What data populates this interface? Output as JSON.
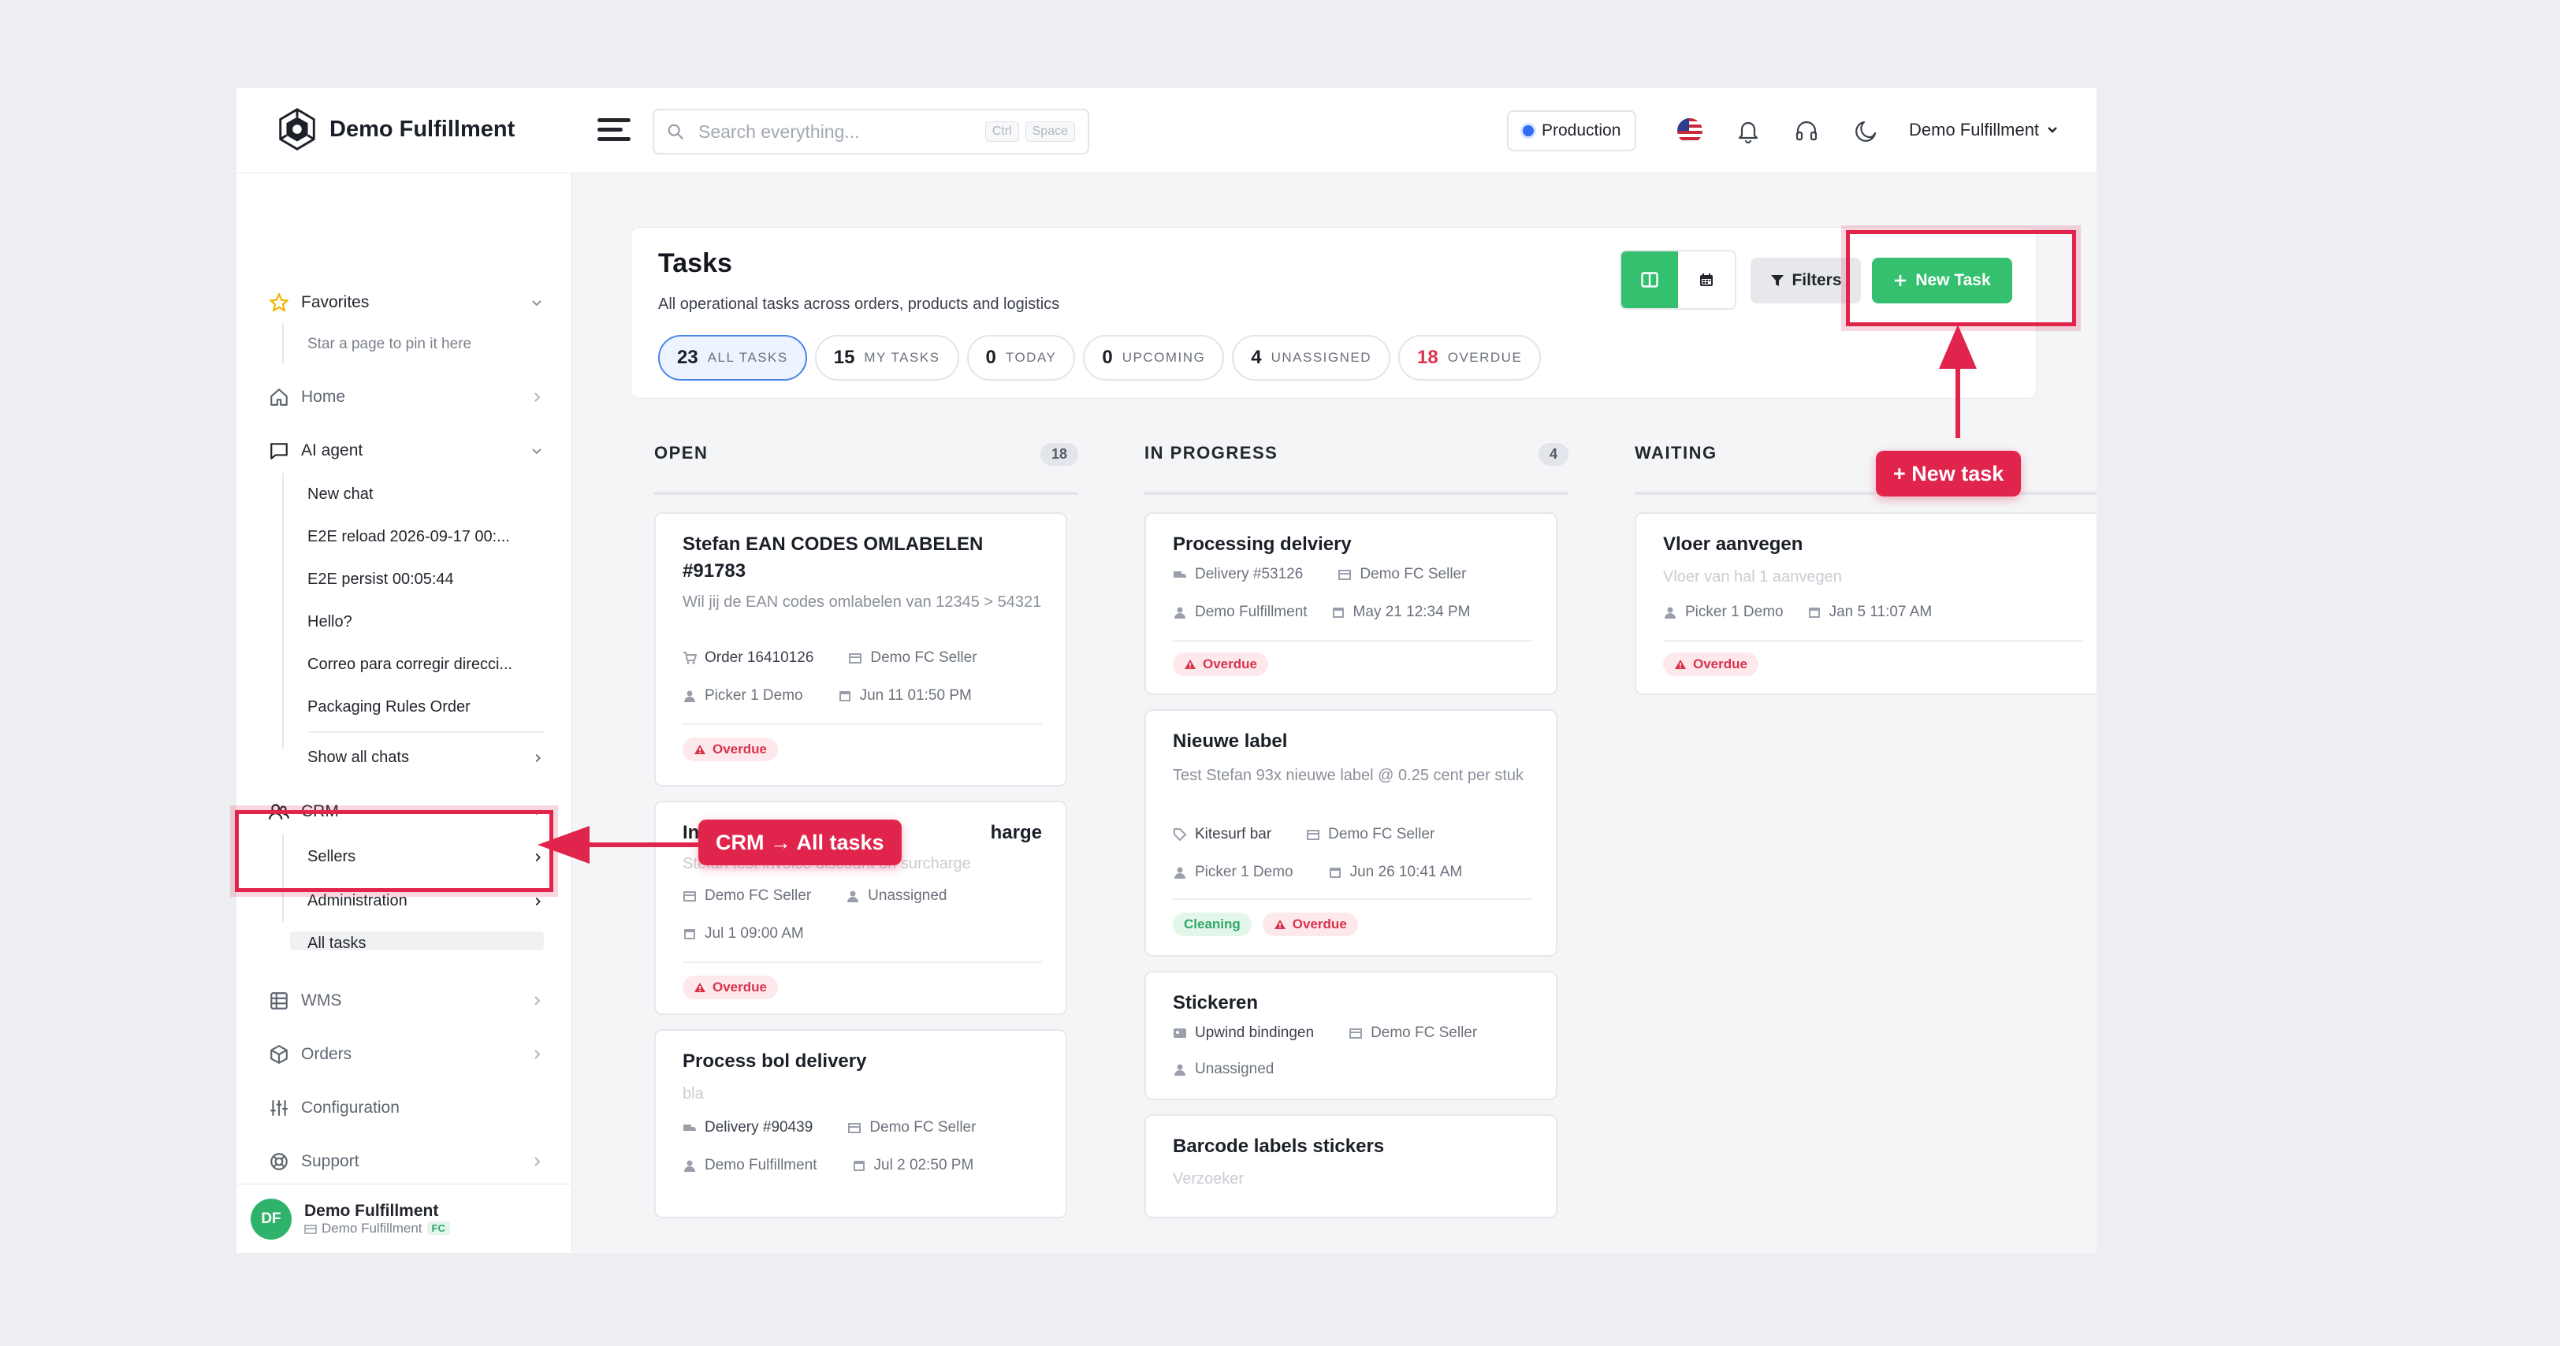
{
  "app": {
    "name": "Demo Fulfillment"
  },
  "search": {
    "placeholder": "Search everything...",
    "kbd1": "Ctrl",
    "kbd2": "Space"
  },
  "topbar": {
    "environment": "Production",
    "user": "Demo Fulfillment"
  },
  "sidebar": {
    "favorites": {
      "label": "Favorites",
      "hint": "Star a page to pin it here"
    },
    "home": "Home",
    "ai_agent": {
      "label": "AI agent",
      "chats": [
        "New chat",
        "E2E reload 2026-09-17 00:...",
        "E2E persist 00:05:44",
        "Hello?",
        "Correo para corregir direcci...",
        "Packaging Rules Order"
      ],
      "show_all": "Show all chats"
    },
    "crm": {
      "label": "CRM",
      "items": [
        "Sellers",
        "Administration",
        "All tasks"
      ]
    },
    "wms": "WMS",
    "orders": "Orders",
    "configuration": "Configuration",
    "support": "Support",
    "footer": {
      "initials": "DF",
      "name": "Demo Fulfillment",
      "sub": "Demo Fulfillment",
      "badge": "FC"
    }
  },
  "tasks": {
    "title": "Tasks",
    "subtitle": "All operational tasks across orders, products and logistics",
    "pills": [
      {
        "count": "23",
        "label": "All tasks"
      },
      {
        "count": "15",
        "label": "My tasks"
      },
      {
        "count": "0",
        "label": "Today"
      },
      {
        "count": "0",
        "label": "Upcoming"
      },
      {
        "count": "4",
        "label": "Unassigned"
      },
      {
        "count": "18",
        "label": "Overdue"
      }
    ],
    "filters_label": "Filters",
    "new_task_label": "New Task"
  },
  "columns": [
    {
      "name": "OPEN",
      "count": "18"
    },
    {
      "name": "IN PROGRESS",
      "count": "4"
    },
    {
      "name": "WAITING",
      "count": ""
    }
  ],
  "cards": {
    "open": [
      {
        "title": "Stefan EAN CODES OMLABELEN #91783",
        "desc": "Wil jij de EAN codes omlabelen van 12345 > 54321",
        "ref": "Order 16410126",
        "seller": "Demo FC Seller",
        "assignee": "Picker 1 Demo",
        "date": "Jun 11 01:50 PM",
        "tag": "Overdue"
      },
      {
        "title_start": "In",
        "title_end": "harge",
        "desc": "Stefan test invoice discount on surcharge",
        "seller": "Demo FC Seller",
        "assignee": "Unassigned",
        "date": "Jul 1 09:00 AM",
        "tag": "Overdue"
      },
      {
        "title": "Process bol delivery",
        "desc": "bla",
        "ref": "Delivery #90439",
        "seller": "Demo FC Seller",
        "assignee": "Demo Fulfillment",
        "date": "Jul 2 02:50 PM"
      }
    ],
    "progress": [
      {
        "title": "Processing delviery",
        "ref": "Delivery #53126",
        "seller": "Demo FC Seller",
        "assignee": "Demo Fulfillment",
        "date": "May 21 12:34 PM",
        "tag": "Overdue"
      },
      {
        "title": "Nieuwe label",
        "desc": "Test Stefan 93x nieuwe label @ 0.25 cent per stuk",
        "ref": "Kitesurf bar",
        "seller": "Demo FC Seller",
        "assignee": "Picker 1 Demo",
        "date": "Jun 26 10:41 AM",
        "tag1": "Cleaning",
        "tag2": "Overdue"
      },
      {
        "title": "Stickeren",
        "ref": "Upwind bindingen",
        "seller": "Demo FC Seller",
        "assignee": "Unassigned"
      },
      {
        "title": "Barcode labels stickers",
        "desc": "Verzoeker"
      }
    ],
    "waiting": [
      {
        "title": "Vloer aanvegen",
        "desc": "Vloer van hal 1 aanvegen",
        "assignee": "Picker 1 Demo",
        "date": "Jan 5 11:07 AM",
        "tag": "Overdue"
      }
    ]
  },
  "annotations": {
    "crm_label": "CRM → All tasks",
    "new_task_label": "+ New task"
  },
  "colors": {
    "accent": "#35c06f",
    "annotation": "#e0244c",
    "overdue": "#d8334b",
    "active_pill": "#4a86e8"
  }
}
